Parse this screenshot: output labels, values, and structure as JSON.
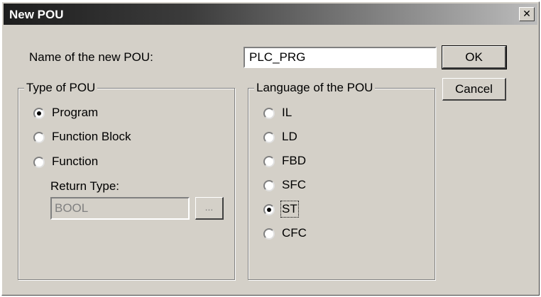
{
  "window": {
    "title": "New POU",
    "close_icon": "close-icon"
  },
  "name": {
    "label": "Name of the new POU:",
    "value": "PLC_PRG"
  },
  "buttons": {
    "ok": "OK",
    "cancel": "Cancel",
    "browse": "..."
  },
  "type_group": {
    "title": "Type of POU",
    "options": [
      {
        "label": "Program",
        "selected": true
      },
      {
        "label": "Function Block",
        "selected": false
      },
      {
        "label": "Function",
        "selected": false
      }
    ],
    "return_type_label": "Return Type:",
    "return_type_value": "BOOL"
  },
  "language_group": {
    "title": "Language of the POU",
    "options": [
      {
        "label": "IL",
        "selected": false
      },
      {
        "label": "LD",
        "selected": false
      },
      {
        "label": "FBD",
        "selected": false
      },
      {
        "label": "SFC",
        "selected": false
      },
      {
        "label": "ST",
        "selected": true
      },
      {
        "label": "CFC",
        "selected": false
      }
    ]
  }
}
